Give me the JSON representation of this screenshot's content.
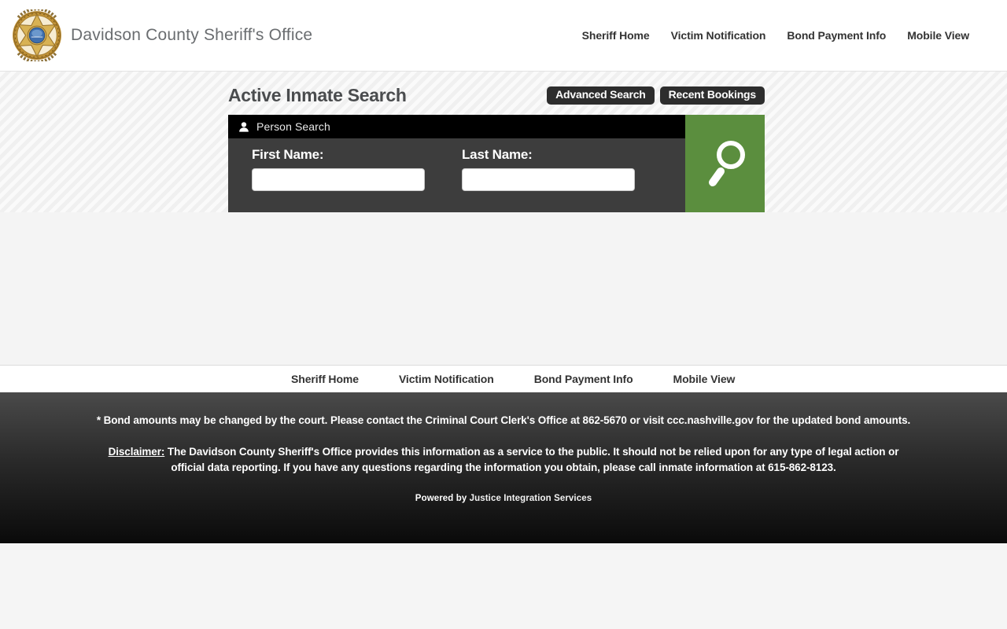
{
  "header": {
    "title": "Davidson County Sheriff's Office",
    "nav": [
      {
        "label": "Sheriff Home"
      },
      {
        "label": "Victim Notification"
      },
      {
        "label": "Bond Payment Info"
      },
      {
        "label": "Mobile View"
      }
    ]
  },
  "search_section": {
    "heading": "Active Inmate Search",
    "advanced_search_label": "Advanced Search",
    "recent_bookings_label": "Recent Bookings",
    "panel": {
      "title": "Person Search",
      "first_name_label": "First Name:",
      "first_name_value": "",
      "last_name_label": "Last Name:",
      "last_name_value": ""
    }
  },
  "footer_nav": {
    "items": [
      {
        "label": "Sheriff Home"
      },
      {
        "label": "Victim Notification"
      },
      {
        "label": "Bond Payment Info"
      },
      {
        "label": "Mobile View"
      }
    ]
  },
  "footer": {
    "bond_note": "* Bond amounts may be changed by the court. Please contact the Criminal Court Clerk's Office at 862-5670 or visit ccc.nashville.gov for the updated bond amounts.",
    "disclaimer_label": "Disclaimer:",
    "disclaimer_text": " The Davidson County Sheriff's Office provides this information as a service to the public. It should not be relied upon for any type of legal action or official data reporting. If you have any questions regarding the information you obtain, please call inmate information at 615-862-8123.",
    "powered_by_prefix": "Powered by ",
    "powered_by_link": "Justice Integration Services"
  },
  "colors": {
    "accent_green": "#5b8e3e",
    "panel_body": "#3d3d3d",
    "panel_header": "#000000",
    "dark_button": "#2d2d2d"
  }
}
